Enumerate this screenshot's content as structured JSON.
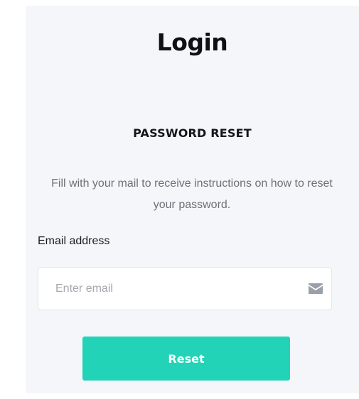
{
  "page": {
    "title": "Login"
  },
  "reset_form": {
    "heading": "PASSWORD RESET",
    "instructions": "Fill with your mail to receive instructions on how to reset your password.",
    "email_label": "Email address",
    "email_value": "",
    "email_placeholder": "Enter email",
    "email_icon": "envelope-icon",
    "submit_label": "Reset"
  },
  "colors": {
    "panel_background": "#f5f6f9",
    "accent": "#22d3b7",
    "title_text": "#0f0f14",
    "muted_text": "#6d7078",
    "placeholder_text": "#a4a7ae",
    "icon": "#9aa0a8"
  }
}
